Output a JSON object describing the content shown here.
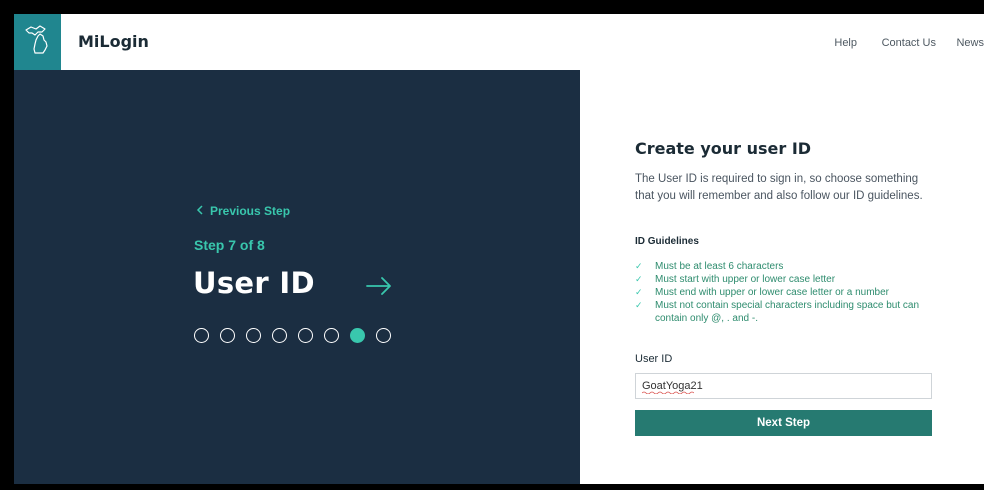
{
  "brand": {
    "name": "MiLogin",
    "logo_icon": "michigan-state-icon",
    "logo_bg": "#20868f"
  },
  "nav": {
    "items": [
      {
        "label": "Help"
      },
      {
        "label": "Contact Us"
      },
      {
        "label": "News"
      }
    ]
  },
  "wizard": {
    "previous_label": "Previous Step",
    "previous_icon": "chevron-left-icon",
    "step_label": "Step 7 of 8",
    "title": "User ID",
    "next_icon": "arrow-right-icon",
    "total_steps": 8,
    "current_step": 7,
    "panel_bg": "#1b2e42",
    "accent": "#39c7ad"
  },
  "form": {
    "title": "Create your user ID",
    "description": "The User ID is required to sign in, so choose something that you will remember and also follow our ID guidelines.",
    "guidelines_title": "ID Guidelines",
    "guidelines": [
      "Must be at least 6 characters",
      "Must start with upper or lower case letter",
      "Must end with upper or lower case letter or a number",
      "Must not contain special characters including space but can contain only @, . and -."
    ],
    "check_icon": "check-icon",
    "field_label": "User ID",
    "field_value": "GoatYoga21",
    "submit_label": "Next Step",
    "button_color": "#267a71"
  }
}
